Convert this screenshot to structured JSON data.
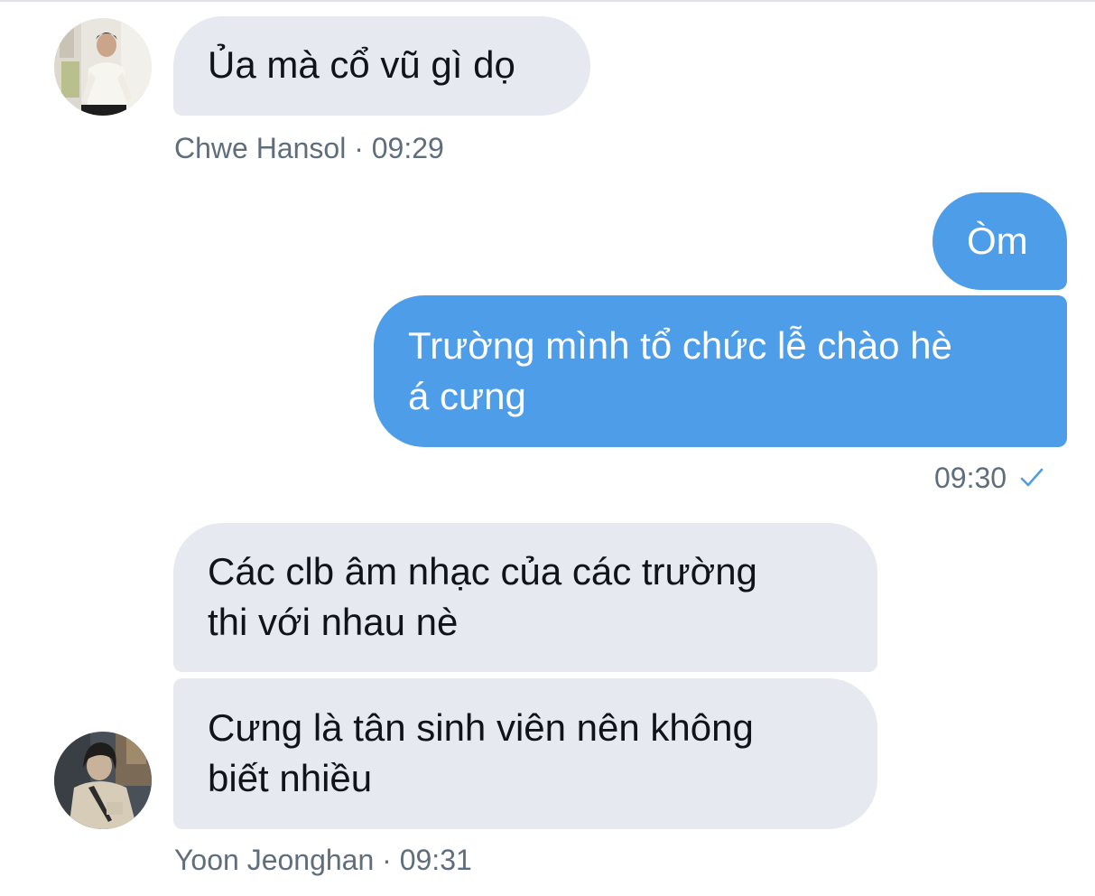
{
  "colors": {
    "incoming_bubble": "#e6e9ef",
    "outgoing_bubble": "#4e9de9",
    "meta_text": "#5f6e7d",
    "check": "#4e9de9"
  },
  "messages": {
    "m1": {
      "text": "Ủa mà cổ vũ gì dọ",
      "sender": "Chwe Hansol",
      "sep": "·",
      "time": "09:29"
    },
    "m2": {
      "text": "Òm"
    },
    "m3": {
      "line1": "Trường mình tổ chức lễ chào hè",
      "line2": "á cưng",
      "time": "09:30",
      "status_icon": "check-icon"
    },
    "m4": {
      "line1": "Các clb âm nhạc của các trường",
      "line2": "thi với nhau nè"
    },
    "m5": {
      "line1": "Cưng là tân sinh viên nên không",
      "line2": "biết nhiều",
      "sender": "Yoon Jeonghan",
      "sep": "·",
      "time": "09:31"
    }
  }
}
